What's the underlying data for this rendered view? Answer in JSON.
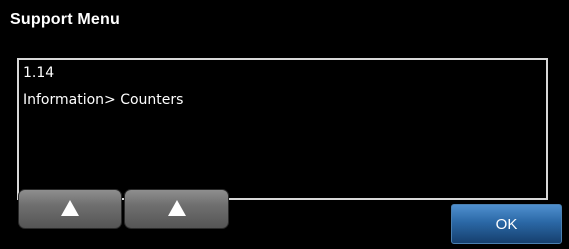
{
  "window": {
    "title": "Support Menu"
  },
  "message_panel": {
    "lines": [
      "1.14",
      "Information> Counters"
    ]
  },
  "scroll_buttons": [
    {
      "icon": "triangle-up-icon"
    },
    {
      "icon": "triangle-up-icon"
    }
  ],
  "ok_button": {
    "label": "OK"
  },
  "colors": {
    "background": "#000000",
    "panel_border": "#d8d8d8",
    "button_gray": "#6f6f6f",
    "ok_blue": "#2b68a6",
    "text": "#ffffff"
  }
}
